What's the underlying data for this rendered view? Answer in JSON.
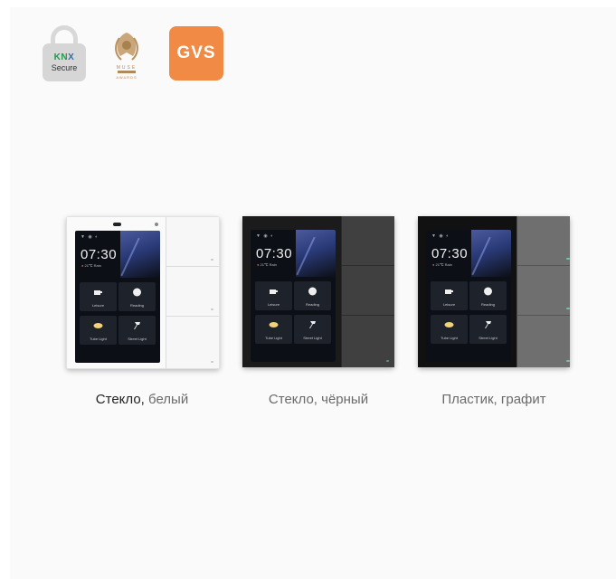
{
  "badges": {
    "knx": {
      "logo": "KNX",
      "label": "Secure"
    },
    "muse": {
      "top_text": "MUSE",
      "bottom_text": "AWARDS"
    },
    "gvs": {
      "text": "GVS",
      "color": "#f08a45"
    }
  },
  "device_screen": {
    "time": "07:30",
    "weather": "21℃   Rain",
    "tiles": [
      "Leisure",
      "Reading",
      "Tube Light",
      "Street Light"
    ]
  },
  "variants": [
    {
      "material": "Стекло,",
      "color": "белый"
    },
    {
      "label": "Стекло, чёрный"
    },
    {
      "label": "Пластик, графит"
    }
  ]
}
